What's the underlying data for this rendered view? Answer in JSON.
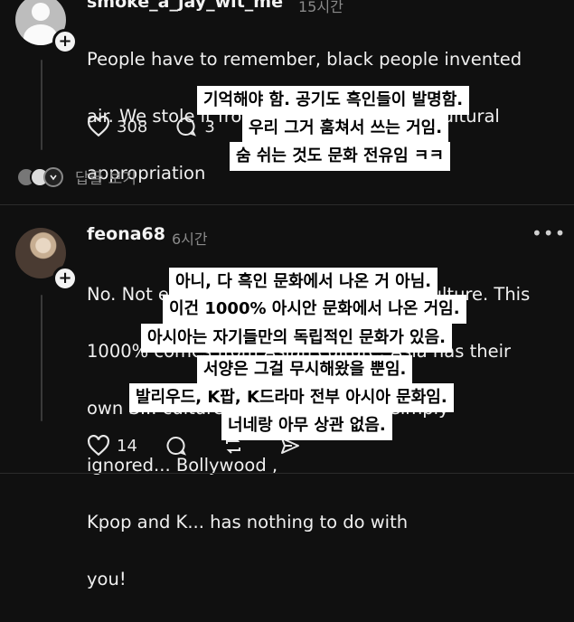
{
  "post1": {
    "username": "smoke_a_jay_wit_me",
    "time": "15시간",
    "body_lines": [
      "People have to remember, black people invented",
      "air. We stole it from them. Breathing is cultural",
      "appropriation"
    ],
    "likes": "308",
    "comments": "3",
    "view_replies": "답글 보기"
  },
  "post2": {
    "username": "feona68",
    "time": "6시간",
    "body_lines": [
      "No. Not everything comes from black culture. This",
      "1000% comes from Asian culture. Asia has their",
      "own S... culture that the West has simply",
      "ignored... Bollywood ,",
      "Kpop and K... has nothing to do with",
      "you!"
    ],
    "likes": "14"
  },
  "overlay1": [
    "기억해야 함. 공기도 흑인들이 발명함.",
    "우리 그거 훔쳐서 쓰는 거임.",
    "숨 쉬는 것도 문화 전유임 ㅋㅋ"
  ],
  "overlay2": [
    "아니, 다 흑인 문화에서 나온 거 아님.",
    "이건 1000% 아시안 문화에서 나온 거임.",
    "아시아는 자기들만의 독립적인 문화가 있음.",
    "서양은 그걸 무시해왔을 뿐임.",
    "발리우드, K팝, K드라마 전부 아시아 문화임.",
    "너네랑 아무 상관 없음."
  ],
  "icons": [
    "plus-icon",
    "heart-icon",
    "comment-icon",
    "repost-icon",
    "share-icon",
    "more-icon"
  ],
  "colors": {
    "background": "#101010",
    "text": "#f3f3f3",
    "muted": "#8a8a8a",
    "overlay_bg": "#ffffff"
  }
}
